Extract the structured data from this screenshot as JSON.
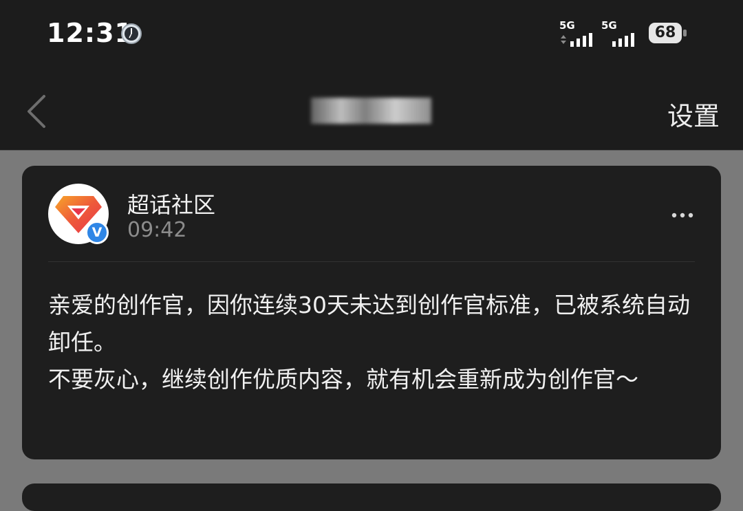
{
  "status_bar": {
    "time": "12:31",
    "clock_icon": "watch-face-icon",
    "signal1_label": "5G",
    "signal2_label": "5G",
    "battery": "68"
  },
  "nav": {
    "back_icon": "chevron-left-icon",
    "settings_label": "设置"
  },
  "message_card": {
    "sender_name": "超话社区",
    "time": "09:42",
    "avatar_icon": "diamond-logo-icon",
    "verified_badge": "V",
    "more_icon": "ellipsis-icon",
    "body_lines": [
      "亲爱的创作官，因你连续30天未达到创作官标准，已被系统自动卸任。",
      "不要灰心，继续创作优质内容，就有机会重新成为创作官～"
    ]
  },
  "colors": {
    "background": "#7a7a7a",
    "bar": "#1c1c1c",
    "card": "#1e1e1e",
    "verified": "#2f86e6",
    "logo_red": "#e8344a",
    "logo_orange": "#f7a52a"
  }
}
